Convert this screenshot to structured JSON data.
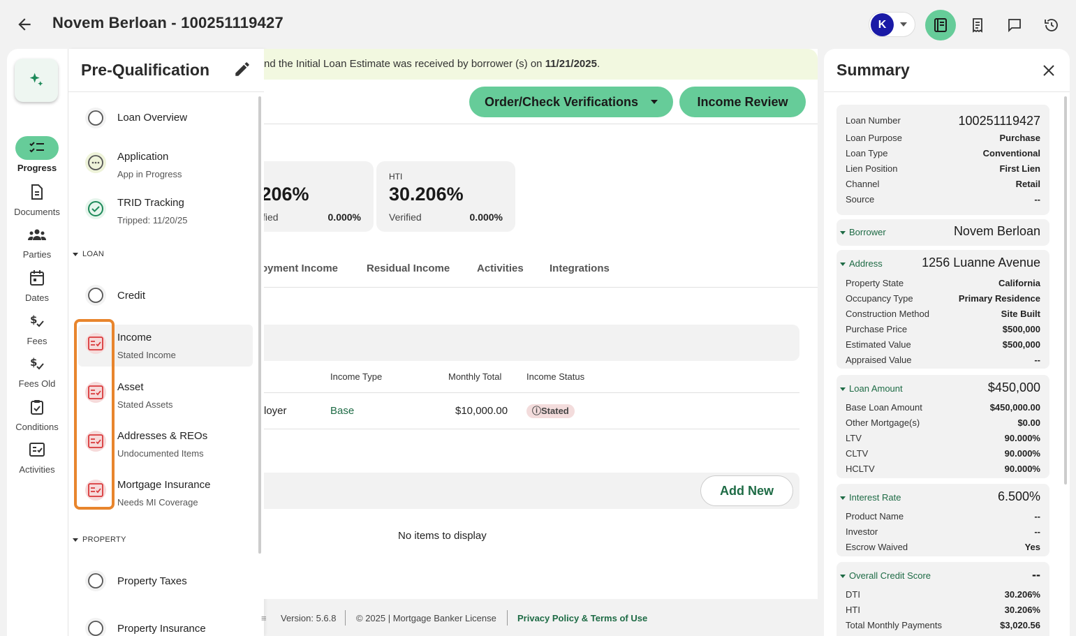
{
  "header": {
    "title": "Novem Berloan - 100251119427",
    "user_initial": "K"
  },
  "colors": {
    "accent_green": "#66cc99",
    "link_green": "#1e6b45",
    "alert_red": "#d9383a",
    "highlight_orange": "#e8852d",
    "avatar_blue": "#1a1aa6"
  },
  "rail": {
    "items": [
      {
        "label": "Progress",
        "icon": "checklist-icon"
      },
      {
        "label": "Documents",
        "icon": "document-icon"
      },
      {
        "label": "Parties",
        "icon": "people-icon"
      },
      {
        "label": "Dates",
        "icon": "calendar-icon"
      },
      {
        "label": "Fees",
        "icon": "dollar-check-icon"
      },
      {
        "label": "Fees Old",
        "icon": "dollar-check-icon"
      },
      {
        "label": "Conditions",
        "icon": "clipboard-check-icon"
      },
      {
        "label": "Activities",
        "icon": "activity-icon"
      }
    ]
  },
  "prequal": {
    "title": "Pre-Qualification",
    "items": {
      "loan_overview": {
        "label": "Loan Overview"
      },
      "application": {
        "label": "Application",
        "sub": "App in Progress"
      },
      "trid": {
        "label": "TRID Tracking",
        "sub": "Tripped: 11/20/25"
      },
      "credit": {
        "label": "Credit"
      },
      "income": {
        "label": "Income",
        "sub": "Stated Income"
      },
      "asset": {
        "label": "Asset",
        "sub": "Stated Assets"
      },
      "addresses": {
        "label": "Addresses & REOs",
        "sub": "Undocumented Items"
      },
      "mortgage_insurance": {
        "label": "Mortgage Insurance",
        "sub": "Needs MI Coverage"
      },
      "property_taxes": {
        "label": "Property Taxes"
      },
      "property_insurance": {
        "label": "Property Insurance"
      }
    },
    "sections": {
      "loan": "LOAN",
      "property": "PROPERTY"
    }
  },
  "main": {
    "banner_text": "nd the Initial Loan Estimate was received by borrower (s) on ",
    "banner_date": "11/21/2025",
    "banner_end": ".",
    "order_button": "Order/Check Verifications",
    "income_review_button": "Income Review",
    "dti": {
      "value": ".206%",
      "foot": "fied",
      "foot_value": "0.000%"
    },
    "hti": {
      "label": "HTI",
      "value": "30.206%",
      "foot": "Verified",
      "foot_value": "0.000%"
    },
    "tabs": [
      "oyment Income",
      "Residual Income",
      "Activities",
      "Integrations"
    ],
    "table": {
      "headers": [
        "Income Type",
        "Monthly Total",
        "Income Status"
      ],
      "row": {
        "source": "loyer",
        "type": "Base",
        "total": "$10,000.00",
        "status": "Stated"
      }
    },
    "add_new": "Add New",
    "empty": "No items to display"
  },
  "footer": {
    "version": "Version: 5.6.8",
    "copyright": "© 2025 | Mortgage Banker License",
    "privacy": "Privacy Policy & Terms of Use"
  },
  "summary": {
    "title": "Summary",
    "loan": {
      "number_label": "Loan Number",
      "number": "100251119427",
      "purpose_label": "Loan Purpose",
      "purpose": "Purchase",
      "type_label": "Loan Type",
      "type": "Conventional",
      "lien_label": "Lien Position",
      "lien": "First Lien",
      "channel_label": "Channel",
      "channel": "Retail",
      "source_label": "Source",
      "source": "--"
    },
    "borrower": {
      "label": "Borrower",
      "value": "Novem Berloan"
    },
    "address": {
      "label": "Address",
      "value": "1256 Luanne Avenue",
      "rows": [
        {
          "k": "Property State",
          "v": "California"
        },
        {
          "k": "Occupancy Type",
          "v": "Primary Residence"
        },
        {
          "k": "Construction Method",
          "v": "Site Built"
        },
        {
          "k": "Purchase Price",
          "v": "$500,000"
        },
        {
          "k": "Estimated Value",
          "v": "$500,000"
        },
        {
          "k": "Appraised Value",
          "v": "--"
        }
      ]
    },
    "loan_amount": {
      "label": "Loan Amount",
      "value": "$450,000",
      "rows": [
        {
          "k": "Base Loan Amount",
          "v": "$450,000.00"
        },
        {
          "k": "Other Mortgage(s)",
          "v": "$0.00"
        },
        {
          "k": "LTV",
          "v": "90.000%"
        },
        {
          "k": "CLTV",
          "v": "90.000%"
        },
        {
          "k": "HCLTV",
          "v": "90.000%"
        }
      ]
    },
    "interest_rate": {
      "label": "Interest Rate",
      "value": "6.500%",
      "rows": [
        {
          "k": "Product Name",
          "v": "--"
        },
        {
          "k": "Investor",
          "v": "--"
        },
        {
          "k": "Escrow Waived",
          "v": "Yes"
        }
      ]
    },
    "credit": {
      "label": "Overall Credit Score",
      "value": "--",
      "rows": [
        {
          "k": "DTI",
          "v": "30.206%"
        },
        {
          "k": "HTI",
          "v": "30.206%"
        },
        {
          "k": "Total Monthly Payments",
          "v": "$3,020.56"
        }
      ]
    }
  }
}
